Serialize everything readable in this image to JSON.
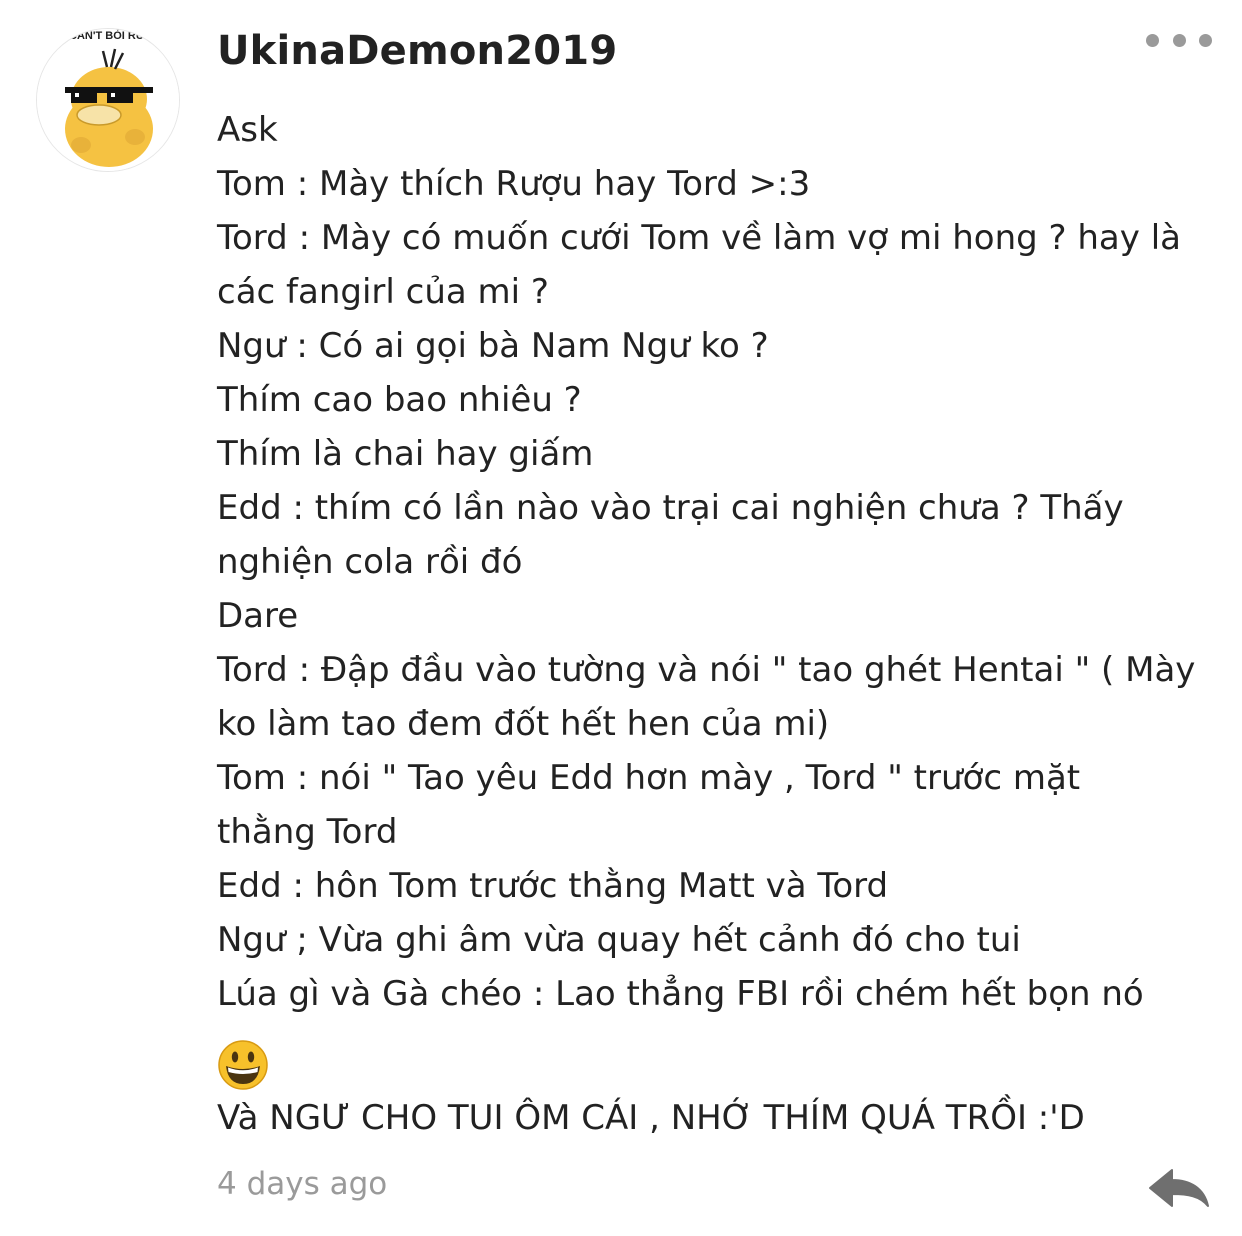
{
  "comment": {
    "author": "UkinaDemon2019",
    "avatar_caption": "CAN'T BỎI RƯ",
    "lines": [
      "Ask",
      "Tom : Mày thích Rượu hay Tord >:3",
      "Tord : Mày có muốn cưới Tom về làm vợ mi hong ? hay là",
      "các fangirl của mi ?",
      "Ngư : Có ai gọi bà Nam Ngư ko ?",
      "Thím cao bao nhiêu ?",
      "Thím là chai hay giấm",
      "Edd : thím có lần nào vào trại cai nghiện chưa ? Thấy",
      "nghiện cola rồi đó",
      "Dare",
      "Tord : Đập đầu vào tường và nói \" tao ghét Hentai \" ( Mày",
      "ko làm tao đem đốt hết hen của mi)",
      "Tom : nói \" Tao yêu Edd hơn mày , Tord \" trước mặt",
      "thằng Tord",
      "Edd : hôn Tom trước thằng Matt và Tord",
      "Ngư ; Vừa ghi âm vừa quay hết cảnh đó cho tui",
      "Lúa gì và Gà chéo : Lao thẳng FBI rồi chém hết bọn nó"
    ],
    "emoji": "grinning-face-emoji",
    "last_line": "Và NGƯ CHO TUI ÔM CÁI , NHỚ THÍM QUÁ TRỒI :'D",
    "timestamp": "4 days ago"
  },
  "icons": {
    "more": "more-options-icon",
    "reply": "reply-arrow-icon"
  },
  "colors": {
    "text": "#222222",
    "muted": "#9a9a9a",
    "emoji_yellow": "#f7c12b",
    "avatar_duck": "#f5c242"
  }
}
